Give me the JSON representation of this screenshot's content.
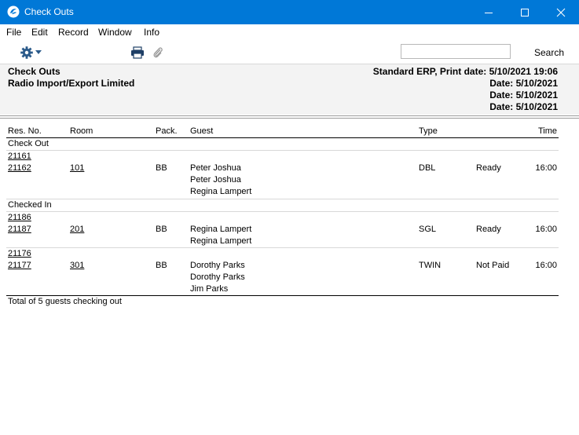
{
  "window": {
    "title": "Check Outs"
  },
  "menu": {
    "file": "File",
    "edit": "Edit",
    "record": "Record",
    "window": "Window",
    "info": "Info"
  },
  "toolbar": {
    "search_value": "",
    "search_label": "Search"
  },
  "report": {
    "title": "Check Outs",
    "company": "Radio Import/Export Limited",
    "print_info": "Standard ERP, Print date: 5/10/2021 19:06",
    "date_lines": [
      "Date: 5/10/2021",
      "Date: 5/10/2021",
      "Date: 5/10/2021"
    ]
  },
  "columns": {
    "res_no": "Res. No.",
    "room": "Room",
    "pack": "Pack.",
    "guest": "Guest",
    "type": "Type",
    "time": "Time"
  },
  "groups": [
    {
      "label": "Check Out",
      "entries": [
        {
          "res_nos": [
            "21161",
            "21162"
          ],
          "room": "101",
          "pack": "BB",
          "guests": [
            "Peter Joshua",
            "Peter Joshua",
            "Regina Lampert"
          ],
          "type": "DBL",
          "status": "Ready",
          "time": "16:00"
        }
      ]
    },
    {
      "label": "Checked In",
      "entries": [
        {
          "res_nos": [
            "21186",
            "21187"
          ],
          "room": "201",
          "pack": "BB",
          "guests": [
            "Regina Lampert",
            "Regina Lampert"
          ],
          "type": "SGL",
          "status": "Ready",
          "time": "16:00"
        },
        {
          "res_nos": [
            "21176",
            "21177"
          ],
          "room": "301",
          "pack": "BB",
          "guests": [
            "Dorothy Parks",
            "Dorothy Parks",
            "Jim Parks"
          ],
          "type": "TWIN",
          "status": "Not Paid",
          "time": "16:00"
        }
      ]
    }
  ],
  "footer": {
    "total": "Total of 5 guests checking out"
  }
}
